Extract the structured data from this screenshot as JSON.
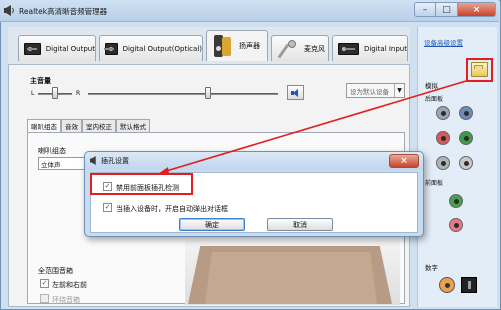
{
  "window": {
    "title": "Realtek高清晰音频管理器",
    "minimize_glyph": "–",
    "maximize_glyph": "□",
    "close_glyph": "×"
  },
  "device_tabs": [
    {
      "label": "Digital Output",
      "icon": "digital-output-device-icon"
    },
    {
      "label": "Digital Output(Optical)",
      "icon": "optical-output-device-icon"
    },
    {
      "label": "扬声器",
      "icon": "speaker-icon",
      "active": true
    },
    {
      "label": "麦克风",
      "icon": "microphone-icon"
    },
    {
      "label": "Digital Input",
      "icon": "digital-input-device-icon"
    }
  ],
  "volume": {
    "label": "主音量",
    "left": "L",
    "right": "R",
    "balance_fraction": 0.5,
    "level_fraction": 0.63,
    "default_device_label": "设为默认设备",
    "dropdown_arrow": "▼"
  },
  "sub_tabs": [
    "喇叭组态",
    "音效",
    "室内校正",
    "默认格式"
  ],
  "speaker_config": {
    "label": "喇叭组态",
    "selected": "立体声"
  },
  "fullrange": {
    "label": "全范围音箱",
    "options": [
      {
        "label": "左前和右前",
        "checked": true,
        "disabled": false
      },
      {
        "label": "环绕音箱",
        "checked": false,
        "disabled": true
      }
    ]
  },
  "right_panel": {
    "advanced_link": "设备高级设置",
    "analog_label": "模拟",
    "back_panel_label": "后面板",
    "front_panel_label": "前面板",
    "digital_label": "数字"
  },
  "dialog": {
    "title": "插孔设置",
    "close_glyph": "×",
    "option1": {
      "label": "禁用前面板插孔检测",
      "checked": true
    },
    "option2": {
      "label": "当插入设备时，开启自动弹出对话框",
      "checked": true
    },
    "ok": "确定",
    "cancel": "取消",
    "check_glyph": "✓"
  },
  "colors": {
    "highlight": "#e21e1e",
    "jacks_back": [
      "#9aa6b2",
      "#6f8bb9",
      "#d75a5a",
      "#3f9b47",
      "#aeb4ba",
      "#c9c9c9"
    ],
    "jacks_front": [
      "#46a04b",
      "#e7788a"
    ]
  }
}
